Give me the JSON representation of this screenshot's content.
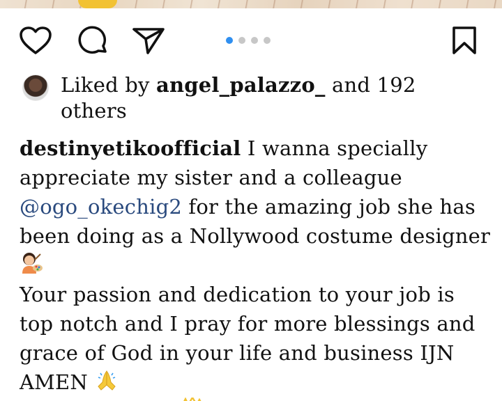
{
  "post": {
    "liked_by_prefix": "Liked by ",
    "liked_by_user": "angel_palazzo_",
    "liked_by_suffix": " and 192 others",
    "carousel": {
      "count": 4,
      "active_index": 0
    },
    "icons": {
      "like": "heart-icon",
      "comment": "comment-icon",
      "share": "send-icon",
      "save": "bookmark-icon"
    },
    "caption": {
      "author": "destinyetikoofficial",
      "text1": " I wanna specially appreciate my sister and a colleague ",
      "mention": "@ogo_okechig2",
      "text2": " for the amazing job she has been doing as a Nollywood costume designer ",
      "emoji1": "woman-artist-emoji",
      "line2": "Your passion and dedication to your job is top notch and I pray for more blessings and grace of God in your life and business IJN AMEN ",
      "emoji2": "folded-hands-emoji"
    },
    "colors": {
      "active_dot": "#2f8ff0",
      "inactive_dot": "#c7c7c7",
      "mention": "#2a4a7e"
    }
  }
}
